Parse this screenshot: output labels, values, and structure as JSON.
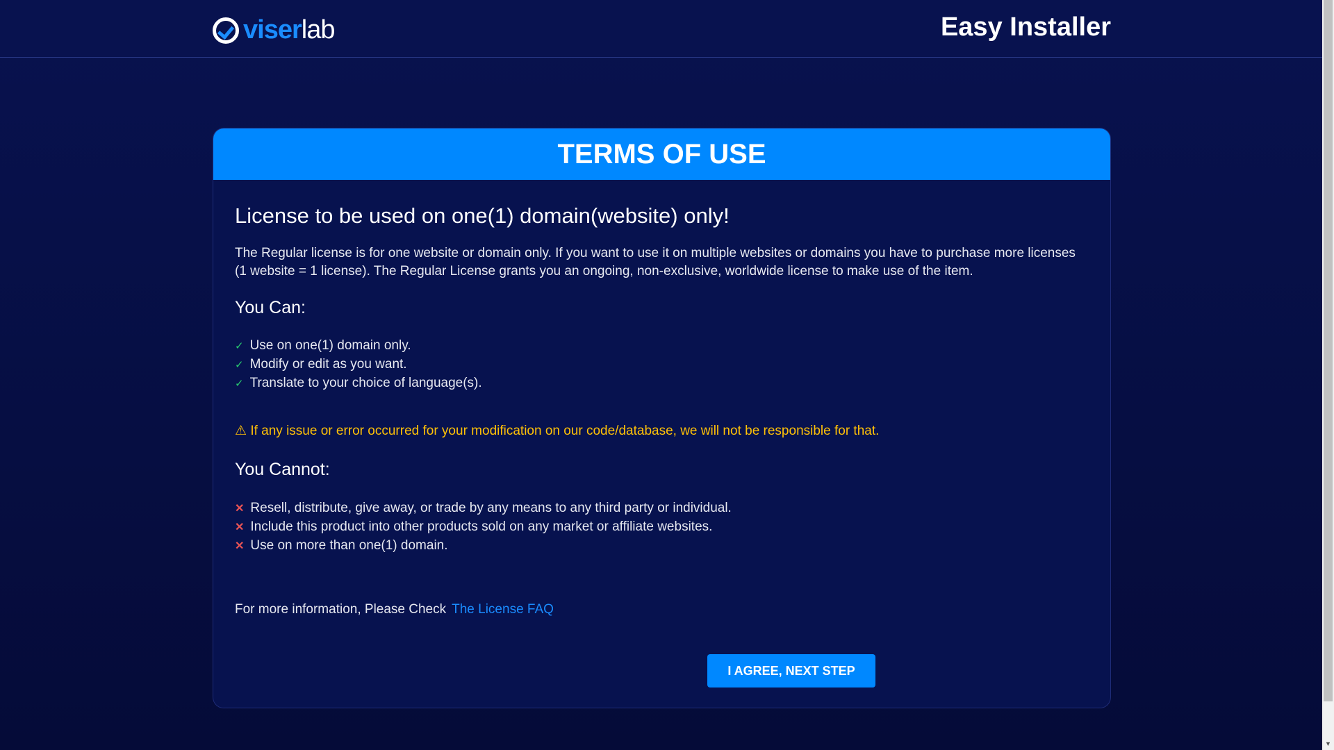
{
  "header": {
    "logo_part1": "viser",
    "logo_part2": "lab",
    "title": "Easy Installer"
  },
  "card": {
    "title": "TERMS OF USE",
    "license_heading": "License to be used on one(1) domain(website) only!",
    "paragraph": "The Regular license is for one website or domain only. If you want to use it on multiple websites or domains you have to purchase more licenses (1 website = 1 license). The Regular License grants you an ongoing, non-exclusive, worldwide license to make use of the item.",
    "can_heading": "You Can:",
    "can_items": [
      "Use on one(1) domain only.",
      "Modify or edit as you want.",
      "Translate to your choice of language(s)."
    ],
    "warning": "If any issue or error occurred for your modification on our code/database, we will not be responsible for that.",
    "cannot_heading": "You Cannot:",
    "cannot_items": [
      "Resell, distribute, give away, or trade by any means to any third party or individual.",
      "Include this product into other products sold on any market or affiliate websites.",
      "Use on more than one(1) domain."
    ],
    "info_text": "For more information, Please Check",
    "info_link": "The License FAQ",
    "agree_button": "I AGREE, NEXT STEP"
  },
  "colors": {
    "primary": "#0088ff",
    "warning": "#ffc107",
    "success": "#28c76f",
    "danger": "#ea5455",
    "background": "#08124f"
  }
}
